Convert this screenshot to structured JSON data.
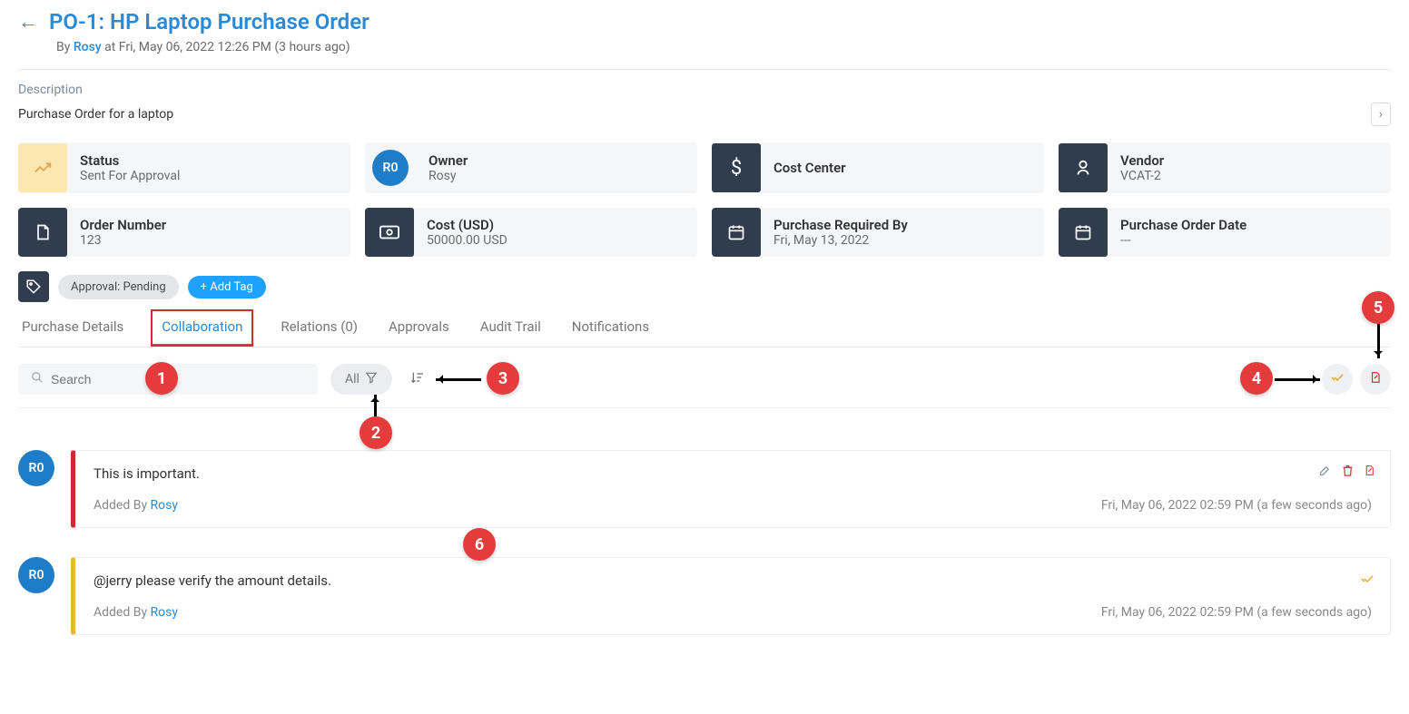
{
  "header": {
    "title": "PO-1: HP Laptop Purchase Order",
    "by_prefix": "By ",
    "author": "Rosy",
    "dateline": " at Fri, May 06, 2022 12:26 PM (3 hours ago)"
  },
  "description": {
    "label": "Description",
    "text": "Purchase Order for a laptop"
  },
  "cards": [
    {
      "label": "Status",
      "value": "Sent For Approval"
    },
    {
      "label": "Owner",
      "value": "Rosy",
      "avatar": "R0"
    },
    {
      "label": "Cost Center",
      "value": ""
    },
    {
      "label": "Vendor",
      "value": "VCAT-2"
    },
    {
      "label": "Order Number",
      "value": "123"
    },
    {
      "label": "Cost (USD)",
      "value": "50000.00 USD"
    },
    {
      "label": "Purchase Required By",
      "value": "Fri, May 13, 2022"
    },
    {
      "label": "Purchase Order Date",
      "value": "---"
    }
  ],
  "tag": {
    "chip": "Approval: Pending",
    "add": "+ Add Tag"
  },
  "tabs": [
    "Purchase Details",
    "Collaboration",
    "Relations (0)",
    "Approvals",
    "Audit Trail",
    "Notifications"
  ],
  "active_tab_index": 1,
  "toolbar": {
    "search_placeholder": "Search",
    "filter_label": "All"
  },
  "annotations": {
    "b1": "1",
    "b2": "2",
    "b3": "3",
    "b4": "4",
    "b5": "5",
    "b6": "6"
  },
  "comments": [
    {
      "avatar": "R0",
      "bar": "red",
      "text": "This is important.",
      "added_by_prefix": "Added By ",
      "added_by": "Rosy",
      "date": "Fri, May 06, 2022 02:59 PM (a few seconds ago)",
      "actions": [
        "edit",
        "delete",
        "doc"
      ]
    },
    {
      "avatar": "R0",
      "bar": "yellow",
      "text": "@jerry please verify the amount details.",
      "added_by_prefix": "Added By ",
      "added_by": "Rosy",
      "date": "Fri, May 06, 2022 02:59 PM (a few seconds ago)",
      "actions": [
        "handshake"
      ]
    }
  ]
}
